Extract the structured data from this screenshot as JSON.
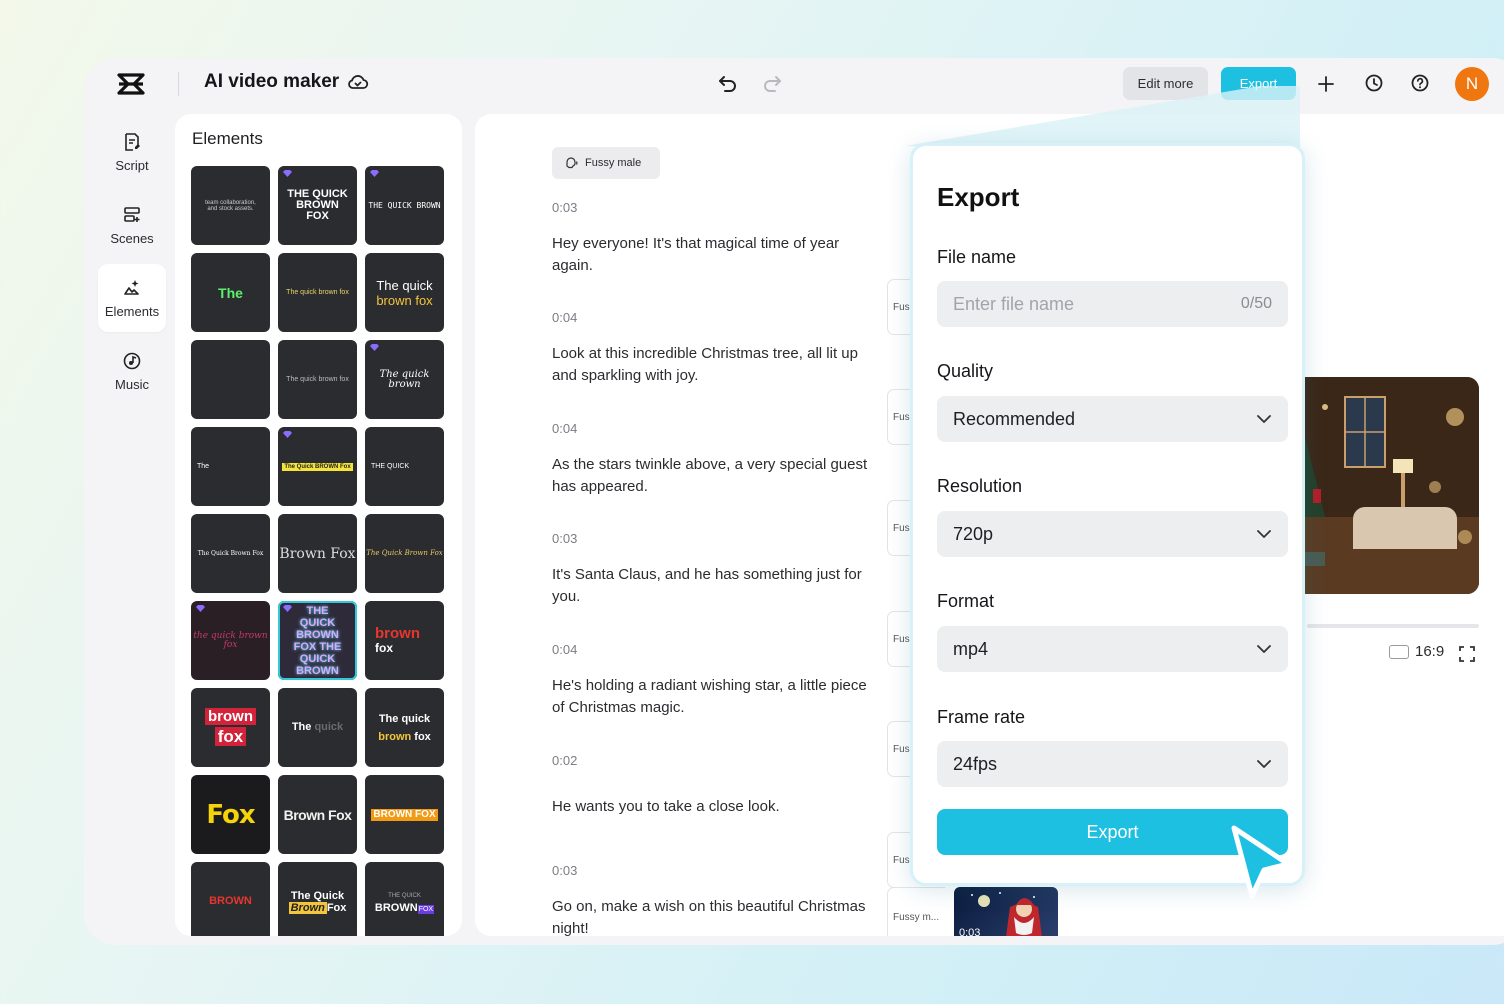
{
  "app": {
    "title": "AI video maker"
  },
  "topbar": {
    "edit_more": "Edit more",
    "export": "Export",
    "avatar_initial": "N"
  },
  "nav": {
    "items": [
      {
        "label": "Script",
        "icon": "script-icon"
      },
      {
        "label": "Scenes",
        "icon": "scenes-icon"
      },
      {
        "label": "Elements",
        "icon": "elements-icon",
        "active": true
      },
      {
        "label": "Music",
        "icon": "music-icon"
      }
    ]
  },
  "elements": {
    "title": "Elements",
    "tiles": [
      "team collaboration, and stock assets.",
      "THE QUICK BROWN FOX",
      "THE QUICK BROWN",
      "The",
      "The quick brown fox",
      "The quick brown fox",
      "",
      "The quick brown fox",
      "The quick brown",
      "The",
      "The Quick BROWN Fox",
      "THE QUICK",
      "The Quick Brown Fox",
      "Brown Fox",
      "The Quick Brown Fox",
      "the quick brown fox",
      "THE QUICK BROWN FOX THE QUICK BROWN",
      "brown fox",
      "brown fox",
      "The quick",
      "The quick brown fox",
      "Fox",
      "Brown Fox",
      "BROWN FOX",
      "BROWN",
      "The Quick Brown Fox",
      "THE QUICK BROWN FOX"
    ]
  },
  "script": {
    "voice": "Fussy male",
    "segments": [
      {
        "time": "0:03",
        "text": "Hey everyone! It's that magical time of year again.",
        "voice": "Fus"
      },
      {
        "time": "0:04",
        "text": "Look at this incredible Christmas tree, all lit up and sparkling with joy.",
        "voice": "Fus"
      },
      {
        "time": "0:04",
        "text": "As the stars twinkle above, a very special guest has appeared.",
        "voice": "Fus"
      },
      {
        "time": "0:03",
        "text": "It's Santa Claus, and he has something just for you.",
        "voice": "Fus"
      },
      {
        "time": "0:04",
        "text": "He's holding a radiant wishing star, a little piece of Christmas magic.",
        "voice": "Fus"
      },
      {
        "time": "0:02",
        "text": "He wants you to take a close look.",
        "voice": "Fus"
      },
      {
        "time": "0:03",
        "text": "Go on, make a wish on this beautiful Christmas night!",
        "voice": "Fussy m..."
      }
    ],
    "thumb_time": "0:03"
  },
  "preview": {
    "ratio": "16:9"
  },
  "export_dialog": {
    "title": "Export",
    "file_name_label": "File name",
    "file_name_placeholder": "Enter file name",
    "file_name_count": "0/50",
    "quality_label": "Quality",
    "quality_value": "Recommended",
    "resolution_label": "Resolution",
    "resolution_value": "720p",
    "format_label": "Format",
    "format_value": "mp4",
    "frame_rate_label": "Frame rate",
    "frame_rate_value": "24fps",
    "export_button": "Export"
  },
  "colors": {
    "accent": "#1ec0e2",
    "avatar": "#f0760f"
  }
}
